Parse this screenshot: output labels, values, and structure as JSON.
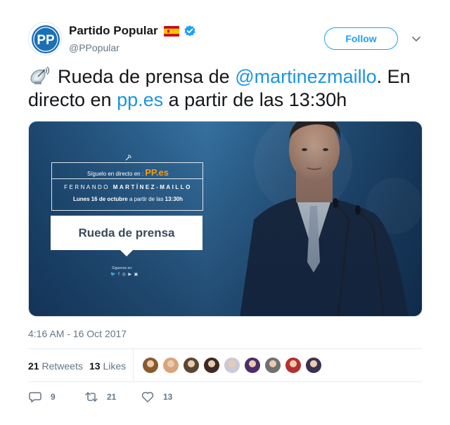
{
  "account": {
    "display_name": "Partido Popular",
    "handle": "@PPopular",
    "avatar_text": "PP",
    "flag": "spain-flag-icon",
    "verified": "verified-badge-icon"
  },
  "follow_button": {
    "label": "Follow"
  },
  "tweet": {
    "text_before_mention": "Rueda de prensa de ",
    "mention": "@martinezmaillo",
    "text_after_mention": ". En directo en ",
    "link": "pp.es",
    "text_end": " a partir de las 13:30h",
    "emoji": "satellite-antenna-icon"
  },
  "media": {
    "line1_prefix": "Síguelo en directo en : ",
    "line1_link": "PP.es",
    "line2_first": "FERNANDO ",
    "line2_last": "MARTÍNEZ-MAILLO",
    "line3_date": "Lunes 16 de octubre",
    "line3_rest": " a partir de las ",
    "line3_time": "13:30h",
    "card_title": "Rueda de prensa",
    "siguenos": "Síguenos en:",
    "socials": "🐦 f ◎ ▶ ▣"
  },
  "timestamp": "4:16 AM - 16 Oct 2017",
  "stats": {
    "retweets_count": "21",
    "retweets_label": "Retweets",
    "likes_count": "13",
    "likes_label": "Likes"
  },
  "likers_colors": [
    "#8a5a2b",
    "#d8a47a",
    "#5b4633",
    "#3d2a25",
    "#c9c9d9",
    "#4b2d6b",
    "#707070",
    "#b53030",
    "#3a3050"
  ],
  "actions": {
    "reply_count": "9",
    "retweet_count": "21",
    "like_count": "13"
  },
  "colors": {
    "link": "#1b95e0",
    "follow": "#1da1f2",
    "secondary_text": "#657786",
    "pp_blue": "#1b6fb5",
    "accent_orange": "#f39c12"
  }
}
